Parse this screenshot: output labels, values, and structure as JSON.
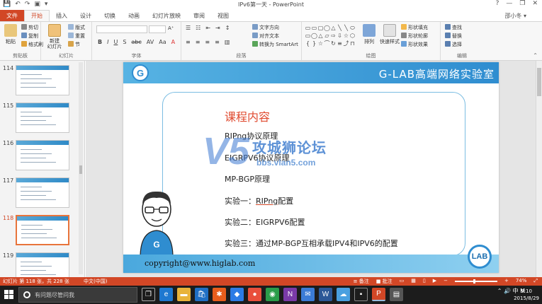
{
  "titlebar": {
    "title": "IPv6第一天 - PowerPoint",
    "help": "?",
    "minimize": "—",
    "restore": "❐",
    "close": "✕"
  },
  "ribbon_tabs": {
    "file": "文件",
    "tabs": [
      "开始",
      "插入",
      "设计",
      "切换",
      "动画",
      "幻灯片放映",
      "审阅",
      "视图"
    ],
    "active_index": 0,
    "user": "邵小冬 ▾"
  },
  "ribbon": {
    "clipboard": {
      "label": "剪贴板",
      "paste": "粘贴",
      "cut": "剪切",
      "copy": "复制",
      "format_painter": "格式刷"
    },
    "slides": {
      "label": "幻灯片",
      "new_slide": "新建\n幻灯片",
      "layout": "版式",
      "reset": "重置",
      "section": "节"
    },
    "font": {
      "label": "字体",
      "tools": [
        "B",
        "I",
        "U",
        "S",
        "abc",
        "AV",
        "Aa",
        "A"
      ]
    },
    "paragraph": {
      "label": "段落",
      "text_direction": "文字方向",
      "align_text": "对齐文本",
      "smartart": "转换为 SmartArt"
    },
    "drawing": {
      "label": "绘图",
      "arrange": "排列",
      "quick_styles": "快速样式",
      "fill": "形状填充",
      "outline": "形状轮廓",
      "effects": "形状效果"
    },
    "editing": {
      "label": "编辑",
      "find": "查找",
      "replace": "替换",
      "select": "选择"
    },
    "shapes": [
      "▭",
      "▭",
      "▢",
      "◯",
      "△",
      "╲",
      "╲",
      "⬭",
      "▭",
      "◯",
      "△",
      "▱",
      "⇨",
      "⇩",
      "☆",
      "⬡",
      "{",
      "}",
      "☆",
      "⌒",
      "↻",
      "≡",
      "⤴",
      "⊓"
    ]
  },
  "thumbnails": [
    {
      "num": "114",
      "selected": false
    },
    {
      "num": "115",
      "selected": false
    },
    {
      "num": "116",
      "selected": false
    },
    {
      "num": "117",
      "selected": false
    },
    {
      "num": "118",
      "selected": true
    },
    {
      "num": "119",
      "selected": false
    }
  ],
  "slide": {
    "header_title": "G-LAB高端网络实验室",
    "g_logo": "G",
    "course_title": "课程内容",
    "items": [
      {
        "text": "RIPng协议原理"
      },
      {
        "text": "EIGRPV6协议原理"
      },
      {
        "text": "MP-BGP原理"
      },
      {
        "text": "实验一：RIPng配置",
        "prefix": "实验一：",
        "underline": "RIPng",
        "suffix": "配置"
      },
      {
        "text": "实验二：EIGRPV6配置"
      },
      {
        "text": "实验三：通过MP-BGP互相承载IPV4和IPV6的配置"
      }
    ],
    "copyright": "copyright@www.higlab.com",
    "lab_badge": "LAB",
    "watermark": {
      "mark": "V5",
      "text": "攻城狮论坛",
      "url": "bbs.vlan5.com"
    }
  },
  "statusbar": {
    "slide_info": "幻灯片 第 118 张，共 228 张",
    "language": "中文(中国)",
    "notes": "≡ 备注",
    "comments": "■ 批注",
    "zoom": "74%"
  },
  "taskbar": {
    "search_placeholder": "有问题尽管问我",
    "time": "9:10",
    "date": "2015/8/29",
    "tray": "⌃ 🔊 中 M"
  },
  "colors": {
    "accent": "#d24726",
    "slide_blue": "#2f8dd0",
    "title_red": "#e04a2f"
  }
}
